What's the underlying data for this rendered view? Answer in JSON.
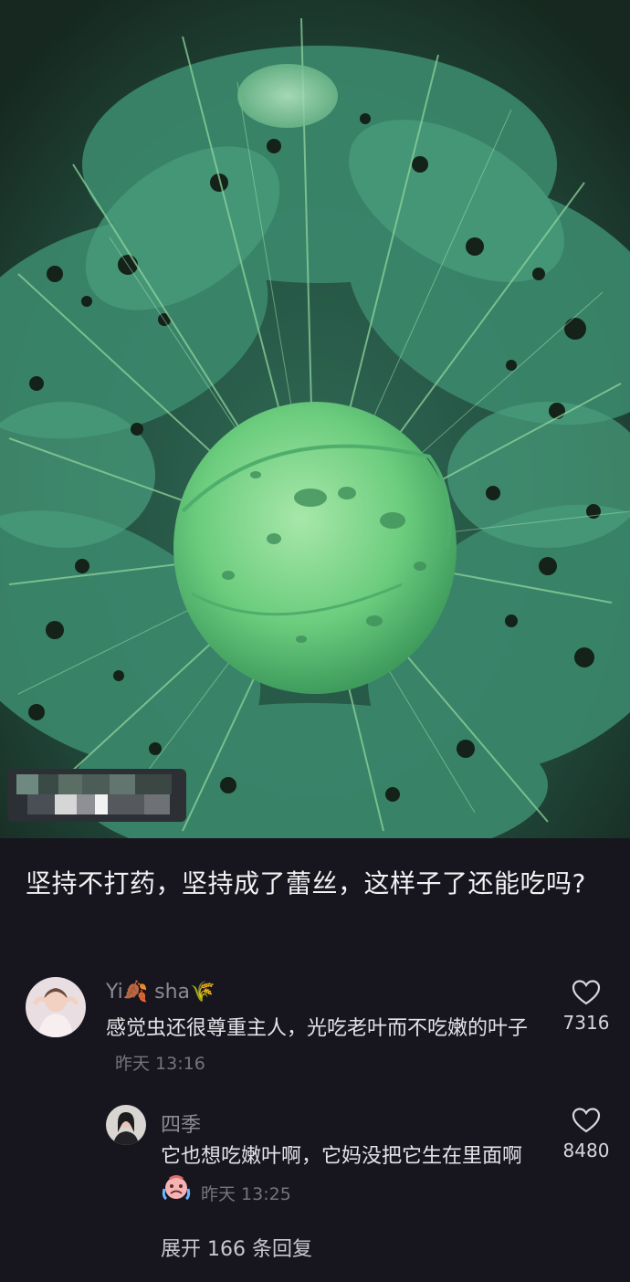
{
  "post": {
    "title": "坚持不打药，坚持成了蕾丝，这样子了还能吃吗?"
  },
  "comments": [
    {
      "username": "Yi🍂 sha🌾",
      "text": "感觉虫还很尊重主人，光吃老叶而不吃嫩的叶子",
      "time": "昨天 13:16",
      "likes": "7316"
    }
  ],
  "reply": {
    "username": "四季",
    "text": "它也想吃嫩叶啊，它妈没把它生在里面啊",
    "time": "昨天 13:25",
    "likes": "8480"
  },
  "expand_label": "展开 166 条回复",
  "colors": {
    "background": "#17161e",
    "cabbage": "#5cc476",
    "leaf": "#3e8f66"
  }
}
